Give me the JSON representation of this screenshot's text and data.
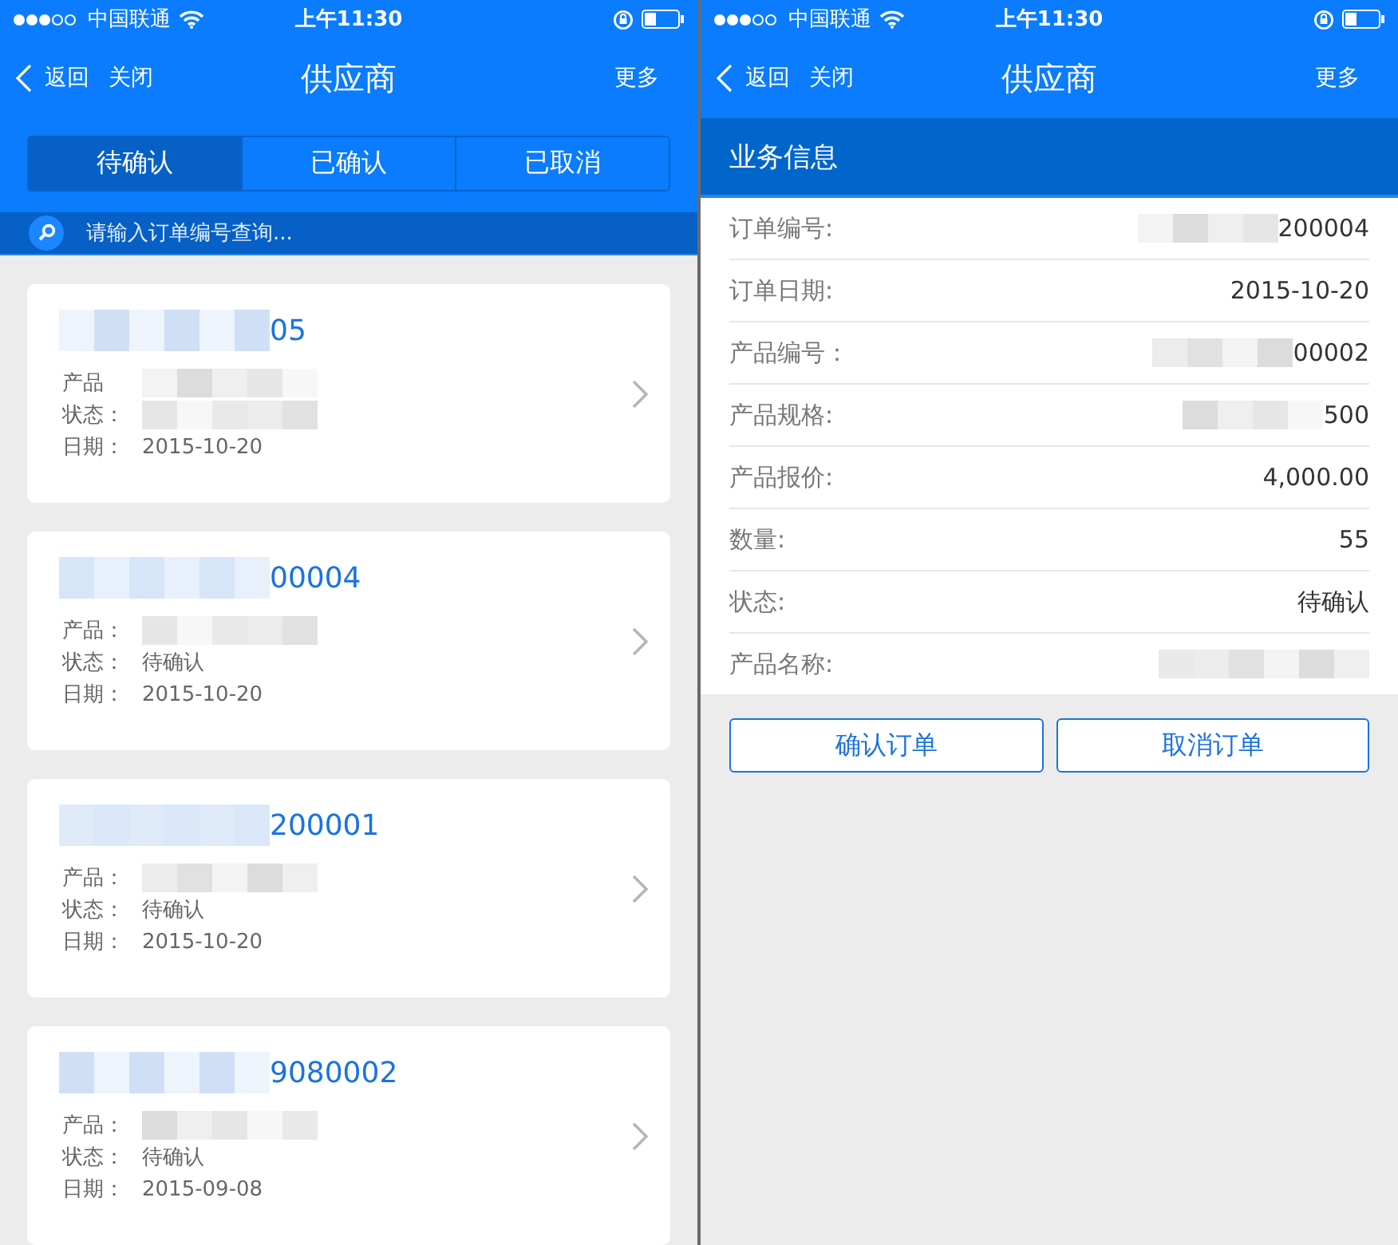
{
  "list_screen": {
    "status_bar": {
      "carrier": "中国联通",
      "time": "上午11:30"
    },
    "nav": {
      "back": "返回",
      "close": "关闭",
      "title": "供应商",
      "more": "更多"
    },
    "tabs": [
      {
        "label": "待确认",
        "selected": true
      },
      {
        "label": "已确认",
        "selected": false
      },
      {
        "label": "已取消",
        "selected": false
      }
    ],
    "search": {
      "placeholder": "请输入订单编号查询..."
    },
    "orders": [
      {
        "number": "05",
        "number_masked": true,
        "fields": [
          {
            "label": "产品",
            "masked": true
          },
          {
            "label": "状态：",
            "masked": true
          },
          {
            "label": "日期：",
            "value": "2015-10-20",
            "masked": false
          }
        ]
      },
      {
        "number": "00004",
        "number_masked": true,
        "fields": [
          {
            "label": "产品：",
            "masked": true
          },
          {
            "label": "状态：",
            "value": "待确认",
            "masked": false
          },
          {
            "label": "日期：",
            "value": "2015-10-20",
            "masked": false
          }
        ]
      },
      {
        "number": "200001",
        "number_masked": true,
        "fields": [
          {
            "label": "产品：",
            "masked": true
          },
          {
            "label": "状态：",
            "value": "待确认",
            "masked": false
          },
          {
            "label": "日期：",
            "value": "2015-10-20",
            "masked": false
          }
        ]
      },
      {
        "number": "9080002",
        "number_masked": true,
        "fields": [
          {
            "label": "产品：",
            "masked": true
          },
          {
            "label": "状态：",
            "value": "待确认",
            "masked": false
          },
          {
            "label": "日期：",
            "value": "2015-09-08",
            "masked": false
          }
        ]
      }
    ]
  },
  "detail_screen": {
    "status_bar": {
      "carrier": "中国联通",
      "time": "上午11:30"
    },
    "nav": {
      "back": "返回",
      "close": "关闭",
      "title": "供应商",
      "more": "更多"
    },
    "section_title": "业务信息",
    "rows": [
      {
        "label": "订单编号:",
        "value": "200004",
        "masked": true
      },
      {
        "label": "订单日期:",
        "value": "2015-10-20",
        "masked": false
      },
      {
        "label": "产品编号：",
        "value": "00002",
        "masked": true
      },
      {
        "label": "产品规格:",
        "value": "500",
        "masked": true
      },
      {
        "label": "产品报价:",
        "value": "4,000.00",
        "masked": false
      },
      {
        "label": "数量:",
        "value": "55",
        "masked": false
      },
      {
        "label": "状态:",
        "value": "待确认",
        "masked": false
      },
      {
        "label": "产品名称:",
        "masked": true
      }
    ],
    "buttons": [
      "确认订单",
      "取消订单"
    ]
  }
}
